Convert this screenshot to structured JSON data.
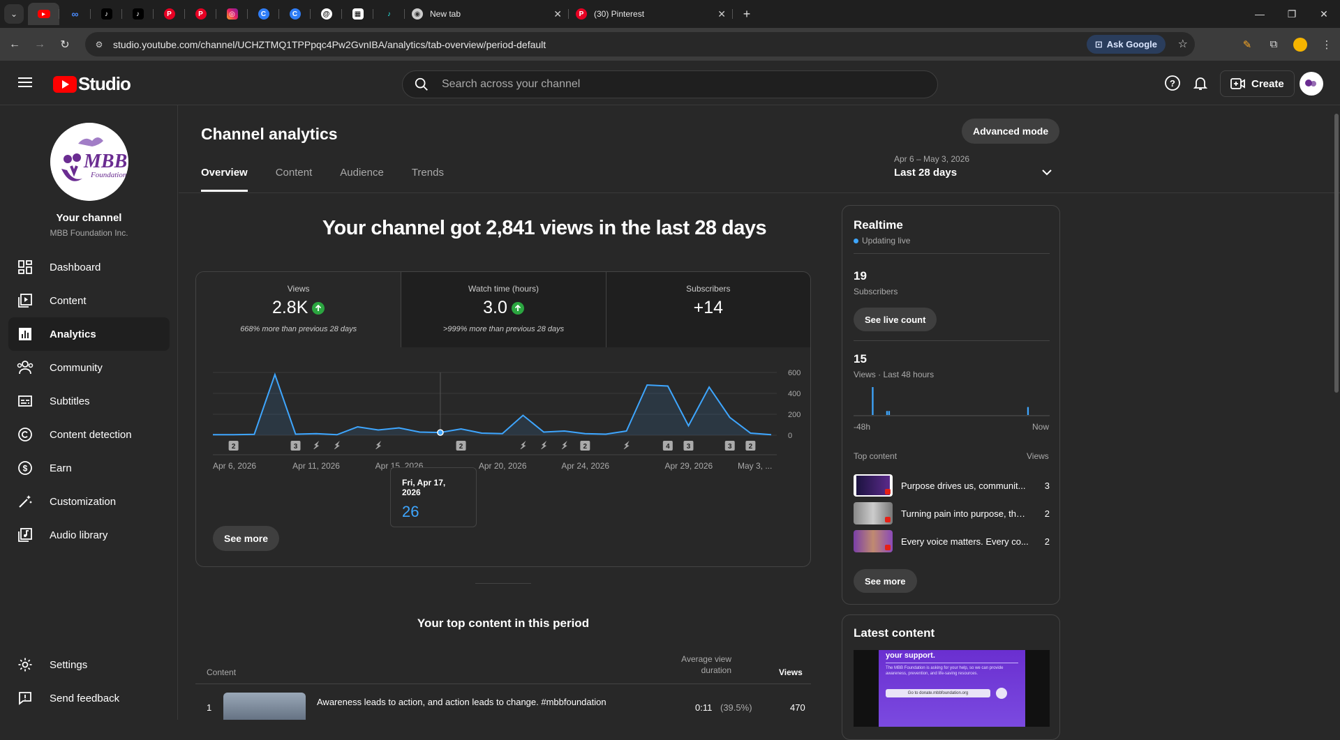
{
  "browser": {
    "tabs": [
      {
        "title": "New tab"
      },
      {
        "title": "(30) Pinterest"
      }
    ],
    "url": "studio.youtube.com/channel/UCHZTMQ1TPPpqc4Pw2GvnIBA/analytics/tab-overview/period-default",
    "ask_google": "Ask Google"
  },
  "studio": {
    "logo": "Studio",
    "search_placeholder": "Search across your channel",
    "create_label": "Create"
  },
  "sidebar": {
    "channel_title": "Your channel",
    "channel_name": "MBB Foundation Inc.",
    "items": [
      {
        "label": "Dashboard",
        "icon": "dashboard-icon"
      },
      {
        "label": "Content",
        "icon": "content-icon"
      },
      {
        "label": "Analytics",
        "icon": "analytics-icon",
        "active": true
      },
      {
        "label": "Community",
        "icon": "community-icon"
      },
      {
        "label": "Subtitles",
        "icon": "subtitles-icon"
      },
      {
        "label": "Content detection",
        "icon": "copyright-icon"
      },
      {
        "label": "Earn",
        "icon": "earn-icon"
      },
      {
        "label": "Customization",
        "icon": "customization-icon"
      },
      {
        "label": "Audio library",
        "icon": "audio-library-icon"
      }
    ],
    "bottom_items": [
      {
        "label": "Settings",
        "icon": "settings-icon"
      },
      {
        "label": "Send feedback",
        "icon": "feedback-icon"
      }
    ]
  },
  "analytics": {
    "title": "Channel analytics",
    "advanced_mode": "Advanced mode",
    "tabs": [
      "Overview",
      "Content",
      "Audience",
      "Trends"
    ],
    "period_range": "Apr 6 – May 3, 2026",
    "period_label": "Last 28 days",
    "headline": "Your channel got 2,841 views in the last 28 days",
    "metrics": [
      {
        "label": "Views",
        "value": "2.8K",
        "note": "668% more than previous 28 days"
      },
      {
        "label": "Watch time (hours)",
        "value": "3.0",
        "note": ">999% more than previous 28 days"
      },
      {
        "label": "Subscribers",
        "value": "+14",
        "note": ""
      }
    ],
    "see_more": "See more",
    "tooltip": {
      "date": "Fri, Apr 17, 2026",
      "value": "26"
    },
    "top_content_title": "Your top content in this period",
    "table_headers": {
      "content": "Content",
      "avg_view_duration": "Average view duration",
      "views": "Views"
    },
    "top_rows": [
      {
        "rank": "1",
        "title": "Awareness leads to action, and action leads to change. #mbbfoundation",
        "duration": "0:11",
        "pct": "(39.5%)",
        "views": "470"
      }
    ]
  },
  "chart_data": {
    "type": "line",
    "x_labels": [
      "Apr 6, 2026",
      "Apr 11, 2026",
      "Apr 15, 2026",
      "Apr 20, 2026",
      "Apr 24, 2026",
      "Apr 29, 2026",
      "May 3, ..."
    ],
    "y_ticks": [
      "600",
      "400",
      "200",
      "0"
    ],
    "ylim": [
      0,
      600
    ],
    "series": [
      {
        "values": [
          5,
          5,
          8,
          580,
          10,
          15,
          5,
          80,
          50,
          70,
          30,
          26,
          60,
          20,
          15,
          190,
          30,
          40,
          15,
          10,
          40,
          480,
          470,
          90,
          460,
          170,
          20,
          5
        ]
      }
    ],
    "markers": [
      {
        "day": 1,
        "label": "2"
      },
      {
        "day": 4,
        "label": "3"
      },
      {
        "day": 5,
        "icon": "short-icon"
      },
      {
        "day": 6,
        "icon": "short-icon"
      },
      {
        "day": 8,
        "icon": "short-icon"
      },
      {
        "day": 12,
        "label": "2"
      },
      {
        "day": 15,
        "icon": "short-icon"
      },
      {
        "day": 16,
        "icon": "short-icon"
      },
      {
        "day": 17,
        "icon": "short-icon"
      },
      {
        "day": 18,
        "label": "2"
      },
      {
        "day": 20,
        "icon": "short-icon"
      },
      {
        "day": 22,
        "label": "4"
      },
      {
        "day": 23,
        "label": "3"
      },
      {
        "day": 25,
        "label": "3"
      },
      {
        "day": 26,
        "label": "2"
      }
    ],
    "highlight_day": 11,
    "line_color": "#3ea6ff"
  },
  "realtime": {
    "title": "Realtime",
    "live": "Updating live",
    "subscribers_value": "19",
    "subscribers_label": "Subscribers",
    "see_live_count": "See live count",
    "views_value": "15",
    "views_label": "Views · Last 48 hours",
    "axis_start": "-48h",
    "axis_end": "Now",
    "top_content_label": "Top content",
    "views_col": "Views",
    "items": [
      {
        "title": "Purpose drives us, communit...",
        "views": "3"
      },
      {
        "title": "Turning pain into purpose, the...",
        "views": "2"
      },
      {
        "title": "Every voice matters. Every co...",
        "views": "2"
      }
    ],
    "see_more": "See more",
    "bars": [
      0,
      0,
      0,
      0,
      0,
      0,
      0,
      0,
      0,
      14,
      0,
      0,
      0,
      0,
      0,
      0,
      2,
      2,
      0,
      0,
      0,
      0,
      0,
      0,
      0,
      0,
      0,
      0,
      0,
      0,
      0,
      0,
      0,
      0,
      0,
      0,
      0,
      0,
      0,
      0,
      0,
      0,
      0,
      0,
      0,
      0,
      0,
      0,
      0,
      0,
      0,
      0,
      0,
      0,
      0,
      0,
      0,
      0,
      0,
      0,
      0,
      0,
      0,
      0,
      0,
      0,
      0,
      0,
      0,
      0,
      0,
      0,
      0,
      0,
      0,
      0,
      0,
      0,
      0,
      0,
      0,
      0,
      0,
      0,
      0,
      4,
      0,
      0,
      0,
      0,
      0,
      0,
      0,
      0,
      0,
      0
    ]
  },
  "latest": {
    "title": "Latest content",
    "thumb_text": "your support.",
    "thumb_body": "The MBB Foundation is asking for your help, so we can provide awareness, prevention, and life-saving resources.",
    "thumb_link": "Go to donate.mbbfoundation.org"
  }
}
